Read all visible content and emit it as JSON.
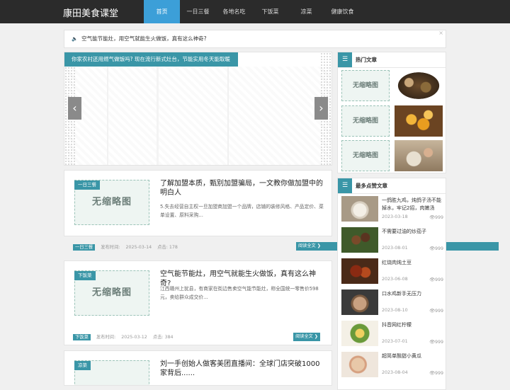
{
  "site": {
    "logo": "康田美食课堂"
  },
  "nav": {
    "items": [
      "首页",
      "一日三餐",
      "各地名吃",
      "下饭菜",
      "凉菜",
      "健康饮食"
    ],
    "active": 0
  },
  "notice": {
    "icon": "speaker-icon",
    "text": "空气能节能灶，用空气就能生火做饭，真有这么神奇?",
    "close": "×"
  },
  "slider": {
    "caption": "你家农村还用燃气做饭吗? 现在流行新式灶台，节能实用冬天能取暖",
    "prev": "‹",
    "next": "›"
  },
  "posts": [
    {
      "category": "一日三餐",
      "placeholder": "无缩略图",
      "title": "了解加盟本质，甄别加盟骗局，一文教你做加盟中的明白人",
      "excerpt": "5.失去经营自主权一旦加盟商加盟一个品牌，店铺的装修风格、产品定价、菜单设置、原料采购...",
      "date_label": "发布时间:",
      "date": "2025-03-14",
      "views_label": "点击:",
      "views": "178",
      "more": "阅读全文"
    },
    {
      "category": "下饭菜",
      "placeholder": "无缩略图",
      "title": "空气能节能灶，用空气就能生火做饭，真有这么神奇?",
      "excerpt": "江西赣州上犹县，有商家在街边售卖空气能节能灶，称全国统一零售价598元，卖给群众成交价...",
      "date_label": "发布时间:",
      "date": "2025-03-12",
      "views_label": "点击:",
      "views": "384",
      "more": "阅读全文"
    },
    {
      "category": "凉菜",
      "placeholder": "无缩略图",
      "title": "刘一手创始人做客美团直播间：全球门店突破1000家背后......"
    }
  ],
  "sidebar": {
    "hot": {
      "title": "热门文章",
      "icon": "list-icon",
      "placeholder": "无缩略图"
    },
    "liked": {
      "title": "最多点赞文章",
      "icon": "list-icon",
      "items": [
        {
          "title": "一鸽胜九鸡，炖鸽子汤不能掉水，牢记2招，肉嫩汤",
          "date": "2023-03-18",
          "views": "999"
        },
        {
          "title": "不需要过油的炒茄子",
          "date": "2023-08-01",
          "views": "999"
        },
        {
          "title": "红烧肉炖土豆",
          "date": "2023-06-08",
          "views": "999"
        },
        {
          "title": "口水鸡新手无压力",
          "date": "2023-08-10",
          "views": "999"
        },
        {
          "title": "抖音网红柠檬",
          "date": "2023-07-01",
          "views": "999"
        },
        {
          "title": "超简单酸甜小黄瓜",
          "date": "2023-08-04",
          "views": "999"
        }
      ]
    }
  },
  "colors": {
    "accent": "#3a96a7",
    "nav_active": "#3c9fd8",
    "topbar": "#2b2b2b"
  }
}
